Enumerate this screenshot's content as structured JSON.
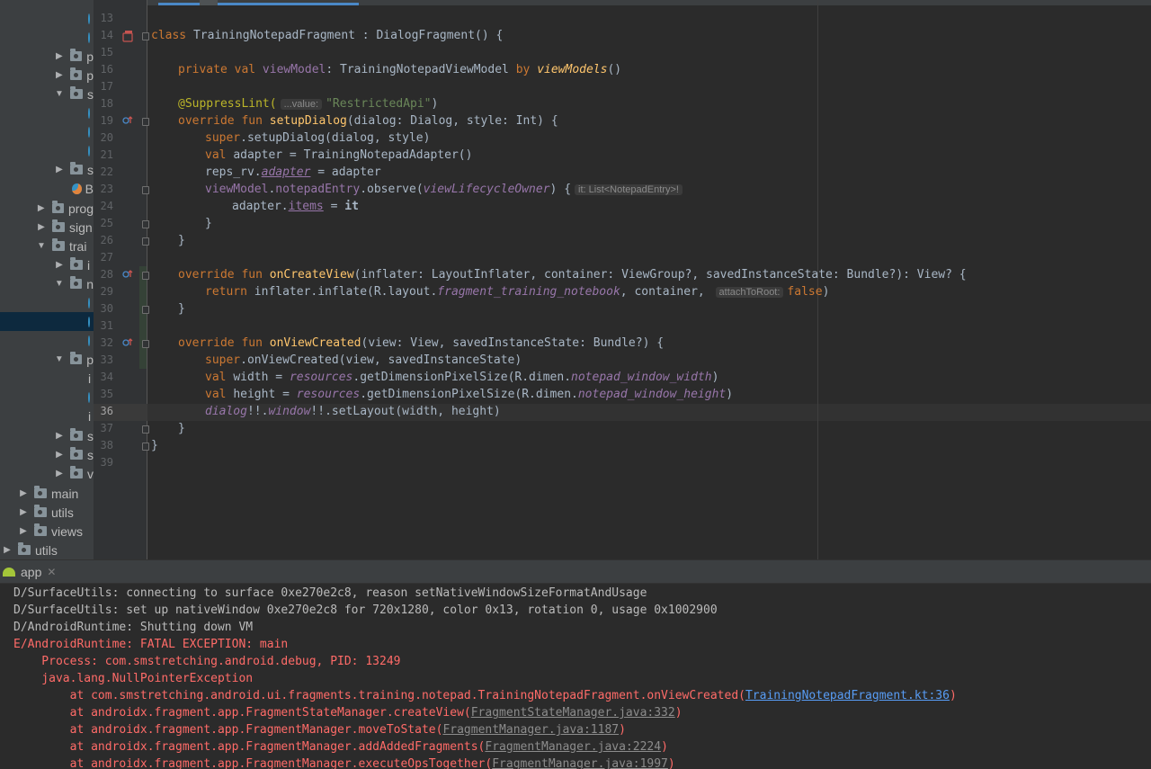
{
  "sidebar": {
    "rows": [
      {
        "label": "",
        "type": "file",
        "indent": 98,
        "arrow": ""
      },
      {
        "label": "",
        "type": "file",
        "indent": 98,
        "arrow": ""
      },
      {
        "label": "p",
        "type": "folder",
        "indent": 60,
        "arrow": "▶"
      },
      {
        "label": "p",
        "type": "folder",
        "indent": 60,
        "arrow": "▶"
      },
      {
        "label": "s",
        "type": "folder",
        "indent": 60,
        "arrow": "▼"
      },
      {
        "label": "",
        "type": "file",
        "indent": 98,
        "arrow": ""
      },
      {
        "label": "",
        "type": "file",
        "indent": 98,
        "arrow": ""
      },
      {
        "label": "",
        "type": "file",
        "indent": 98,
        "arrow": ""
      },
      {
        "label": "s",
        "type": "folder",
        "indent": 60,
        "arrow": "▶"
      },
      {
        "label": "B",
        "type": "fileex",
        "indent": 80,
        "arrow": ""
      },
      {
        "label": "prog",
        "type": "folder",
        "indent": 40,
        "arrow": "▶"
      },
      {
        "label": "sign",
        "type": "folder",
        "indent": 40,
        "arrow": "▶"
      },
      {
        "label": "trai",
        "type": "folder",
        "indent": 40,
        "arrow": "▼"
      },
      {
        "label": "i",
        "type": "folder",
        "indent": 60,
        "arrow": "▶"
      },
      {
        "label": "n",
        "type": "folder",
        "indent": 60,
        "arrow": "▼"
      },
      {
        "label": "",
        "type": "file",
        "indent": 98,
        "arrow": ""
      },
      {
        "label": "",
        "type": "file",
        "indent": 98,
        "arrow": "",
        "selected": true
      },
      {
        "label": "",
        "type": "file",
        "indent": 98,
        "arrow": ""
      },
      {
        "label": "p",
        "type": "folder",
        "indent": 60,
        "arrow": "▼"
      },
      {
        "label": "i",
        "type": "plain",
        "indent": 98,
        "arrow": ""
      },
      {
        "label": "",
        "type": "file",
        "indent": 98,
        "arrow": ""
      },
      {
        "label": "i",
        "type": "plain",
        "indent": 98,
        "arrow": ""
      },
      {
        "label": "s",
        "type": "folder",
        "indent": 60,
        "arrow": "▶"
      },
      {
        "label": "s",
        "type": "folder",
        "indent": 60,
        "arrow": "▶"
      },
      {
        "label": "v",
        "type": "folder",
        "indent": 60,
        "arrow": "▶"
      },
      {
        "label": "main",
        "type": "folder",
        "indent": 20,
        "arrow": "▶"
      },
      {
        "label": "utils",
        "type": "folder",
        "indent": 20,
        "arrow": "▶"
      },
      {
        "label": "views",
        "type": "folder",
        "indent": 20,
        "arrow": "▶"
      },
      {
        "label": "utils",
        "type": "folder",
        "indent": 2,
        "arrow": "▶"
      }
    ]
  },
  "editor": {
    "line_numbers": [
      "13",
      "14",
      "15",
      "16",
      "17",
      "18",
      "19",
      "20",
      "21",
      "22",
      "23",
      "24",
      "25",
      "26",
      "27",
      "28",
      "29",
      "30",
      "31",
      "32",
      "33",
      "34",
      "35",
      "36",
      "37",
      "38",
      "39"
    ],
    "current_line": "36",
    "code": {
      "l14_kw": "class ",
      "l14_rest": "TrainingNotepadFragment : DialogFragment() {",
      "l16_kw": "private val ",
      "l16_prop": "viewModel",
      "l16_type": ": TrainingNotepadViewModel ",
      "l16_by": "by ",
      "l16_fn": "viewModels",
      "l16_end": "()",
      "l18_ann": "@SuppressLint(",
      "l18_hint": "...value:",
      "l18_str": "\"RestrictedApi\"",
      "l18_end": ")",
      "l19_kw": "override fun ",
      "l19_fn": "setupDialog",
      "l19_rest": "(dialog: Dialog, style: Int) {",
      "l20_kw": "super",
      "l20_rest": ".setupDialog(dialog, style)",
      "l21_kw": "val ",
      "l21_rest": "adapter = TrainingNotepadAdapter()",
      "l22_a": "reps_rv.",
      "l22_prop": "adapter",
      "l22_rest": " = adapter",
      "l23_prop": "viewModel",
      "l23_b": ".",
      "l23_prop2": "notepadEntry",
      "l23_c": ".observe(",
      "l23_prop3": "viewLifecycleOwner",
      "l23_d": ") {",
      "l23_hint": "it: List<NotepadEntry>!",
      "l24_a": "adapter.",
      "l24_prop": "items",
      "l24_b": " = ",
      "l24_it": "it",
      "l25": "}",
      "l26": "}",
      "l28_kw": "override fun ",
      "l28_fn": "onCreateView",
      "l28_rest": "(inflater: LayoutInflater, container: ViewGroup?, savedInstanceState: Bundle?): View? {",
      "l29_kw": "return ",
      "l29_a": "inflater.inflate(R.layout.",
      "l29_prop": "fragment_training_notebook",
      "l29_b": ", container, ",
      "l29_hint": "attachToRoot:",
      "l29_false": "false",
      "l29_end": ")",
      "l30": "}",
      "l32_kw": "override fun ",
      "l32_fn": "onViewCreated",
      "l32_rest": "(view: View, savedInstanceState: Bundle?) {",
      "l33_kw": "super",
      "l33_rest": ".onViewCreated(view, savedInstanceState)",
      "l34_kw": "val ",
      "l34_a": "width = ",
      "l34_prop": "resources",
      "l34_b": ".getDimensionPixelSize(R.dimen.",
      "l34_prop2": "notepad_window_width",
      "l34_end": ")",
      "l35_kw": "val ",
      "l35_a": "height = ",
      "l35_prop": "resources",
      "l35_b": ".getDimensionPixelSize(R.dimen.",
      "l35_prop2": "notepad_window_height",
      "l35_end": ")",
      "l36_prop": "dialog",
      "l36_a": "!!.",
      "l36_prop2": "window",
      "l36_b": "!!.setLayout(width, height)",
      "l37": "}",
      "l38": "}"
    }
  },
  "run_panel": {
    "tab_label": "app",
    "close_label": "✕",
    "lines": {
      "c1": "D/SurfaceUtils: connecting to surface 0xe270e2c8, reason setNativeWindowSizeFormatAndUsage",
      "c2": "D/SurfaceUtils: set up nativeWindow 0xe270e2c8 for 720x1280, color 0x13, rotation 0, usage 0x1002900",
      "c3": "D/AndroidRuntime: Shutting down VM",
      "c4": "E/AndroidRuntime: FATAL EXCEPTION: main",
      "c5": "    Process: com.smstretching.android.debug, PID: 13249",
      "c6": "    java.lang.NullPointerException",
      "c7_a": "        at com.smstretching.android.ui.fragments.training.notepad.TrainingNotepadFragment.onViewCreated(",
      "c7_link": "TrainingNotepadFragment.kt:36",
      "c7_end": ")",
      "c8_a": "        at androidx.fragment.app.FragmentStateManager.createView(",
      "c8_link": "FragmentStateManager.java:332",
      "c8_end": ")",
      "c9_a": "        at androidx.fragment.app.FragmentManager.moveToState(",
      "c9_link": "FragmentManager.java:1187",
      "c9_end": ")",
      "c10_a": "        at androidx.fragment.app.FragmentManager.addAddedFragments(",
      "c10_link": "FragmentManager.java:2224",
      "c10_end": ")",
      "c11_a": "        at androidx.fragment.app.FragmentManager.executeOpsTogether(",
      "c11_link": "FragmentManager.java:1997",
      "c11_end": ")"
    }
  },
  "colors": {
    "keyword": "#cc7832",
    "function": "#ffc66d",
    "string": "#6a8759",
    "annotation": "#bbb529",
    "property": "#9876aa",
    "error": "#ff6b68",
    "link": "#589df6"
  }
}
